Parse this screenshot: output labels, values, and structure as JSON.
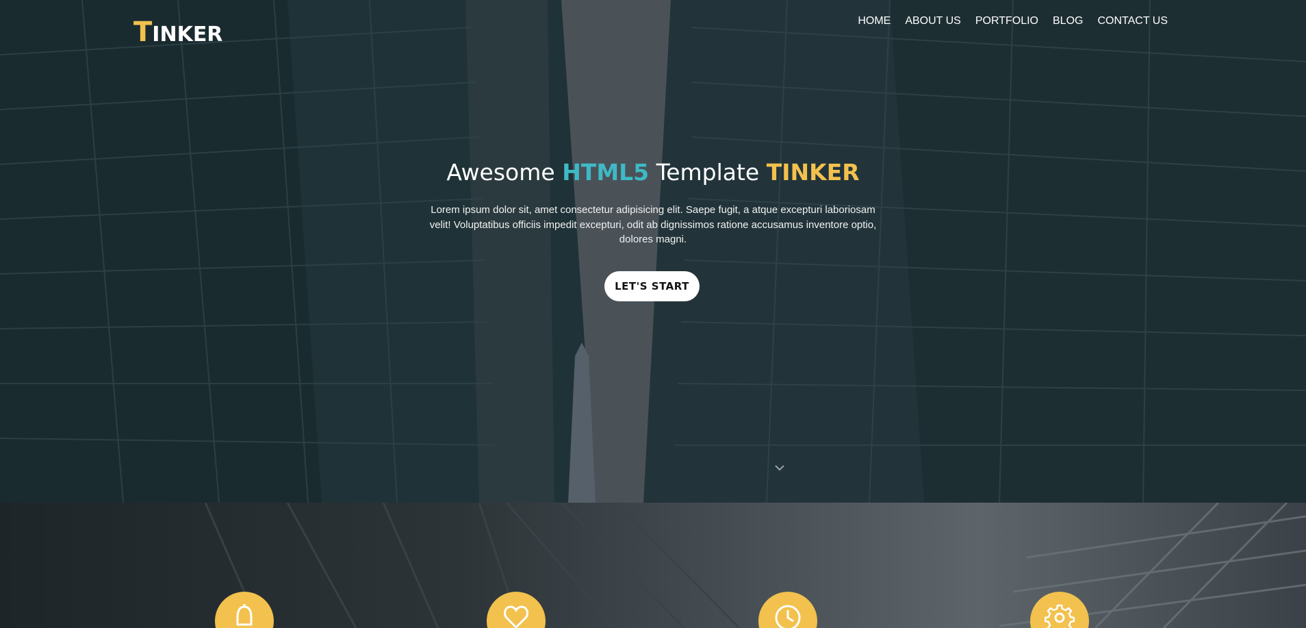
{
  "brand": {
    "logo_initial": "T",
    "logo_rest": "INKER",
    "accent_gold": "#f2c14e",
    "accent_cyan": "#3fb9c6"
  },
  "nav": {
    "items": [
      {
        "label": "HOME"
      },
      {
        "label": "ABOUT US"
      },
      {
        "label": "PORTFOLIO"
      },
      {
        "label": "BLOG"
      },
      {
        "label": "CONTACT US"
      }
    ]
  },
  "hero": {
    "title_part1": "Awesome ",
    "title_highlight1": "HTML5",
    "title_part2": " Template ",
    "title_highlight2": "TINKER",
    "description": "Lorem ipsum dolor sit, amet consectetur adipisicing elit. Saepe fugit, a atque excepturi laboriosam velit! Voluptatibus officiis impedit excepturi, odit ab dignissimos ratione accusamus inventore optio, dolores magni.",
    "cta_label": "LET'S START",
    "scroll_icon": "chevron-down-icon"
  },
  "features": {
    "icons": [
      "bell-icon",
      "heart-icon",
      "clock-icon",
      "gear-icon"
    ]
  }
}
